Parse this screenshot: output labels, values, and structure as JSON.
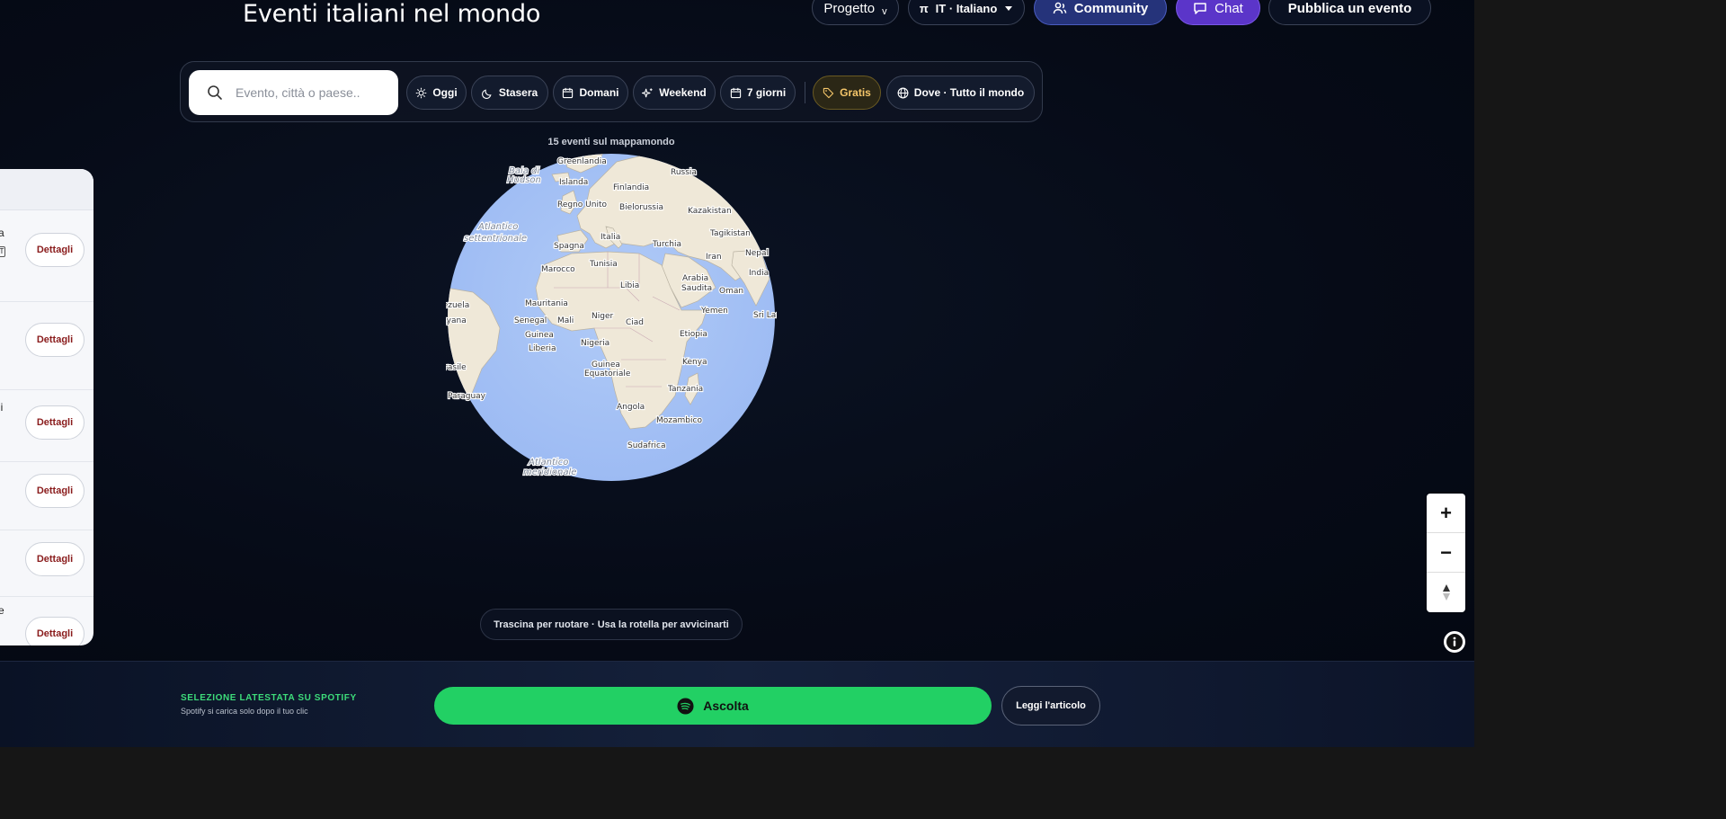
{
  "header": {
    "title": "Eventi italiani nel mondo",
    "progetto_label": "Progetto",
    "progetto_chevron": "v",
    "lang_label": "IT · Italiano",
    "lang_prefix": "π",
    "community_label": "Community",
    "chat_label": "Chat",
    "publish_label": "Pubblica un evento"
  },
  "filters": {
    "search_placeholder": "Evento, città o paese..",
    "chips": {
      "oggi": "Oggi",
      "stasera": "Stasera",
      "domani": "Domani",
      "weekend": "Weekend",
      "sette_giorni": "7 giorni",
      "gratis": "Gratis",
      "dove": "Dove · Tutto il mondo"
    }
  },
  "map": {
    "count_label": "15 eventi sul mappamondo",
    "hint": "Trascina per ruotare · Usa la rotella per avvicinarti",
    "place_labels": [
      "Greenlandia",
      "Baia di",
      "Hudson",
      "Islanda",
      "Russia",
      "Finlandia",
      "Regno Unito",
      "Bielorussia",
      "Kazakistan",
      "Atlantico",
      "settentrionale",
      "Italia",
      "Tagikistan",
      "Spagna",
      "Turchia",
      "Iran",
      "Nepal",
      "Marocco",
      "Tunisia",
      "Arabia",
      "Saudita",
      "India",
      "Libia",
      "Oman",
      "Venezuela",
      "Mauritania",
      "Yemen",
      "Guyana",
      "Senegal",
      "Mali",
      "Niger",
      "Ciad",
      "Sri Lanka",
      "Guinea",
      "Etiopia",
      "Liberia",
      "Nigeria",
      "Brasile",
      "Kenya",
      "Guinea",
      "Equatoriale",
      "Paraguay",
      "Tanzania",
      "Angola",
      "Mozambico",
      "Sudafrica",
      "Atlantico",
      "meridionale"
    ],
    "zoom_in": "+",
    "zoom_out": "−"
  },
  "side_panel": {
    "details_label": "Dettagli",
    "fragments": [
      "a",
      "T",
      "li",
      "e"
    ]
  },
  "footer": {
    "spotify_title": "SELEZIONE LATESTATA SU SPOTIFY",
    "spotify_sub": "Spotify si carica solo dopo il tuo clic",
    "listen_label": "Ascolta",
    "read_label": "Leggi l'articolo"
  },
  "colors": {
    "background": "#050a16",
    "accent_green": "#22d064",
    "community": "#25337a",
    "chat": "#5b35c9",
    "gratis": "#f5c66a",
    "ocean": "#a8c4f5"
  },
  "icons": [
    "search-icon",
    "sun-icon",
    "moon-icon",
    "calendar-icon",
    "sparkle-icon",
    "tag-icon",
    "globe-icon",
    "users-icon",
    "chat-icon",
    "spotify-icon",
    "info-icon",
    "compass-icon"
  ]
}
